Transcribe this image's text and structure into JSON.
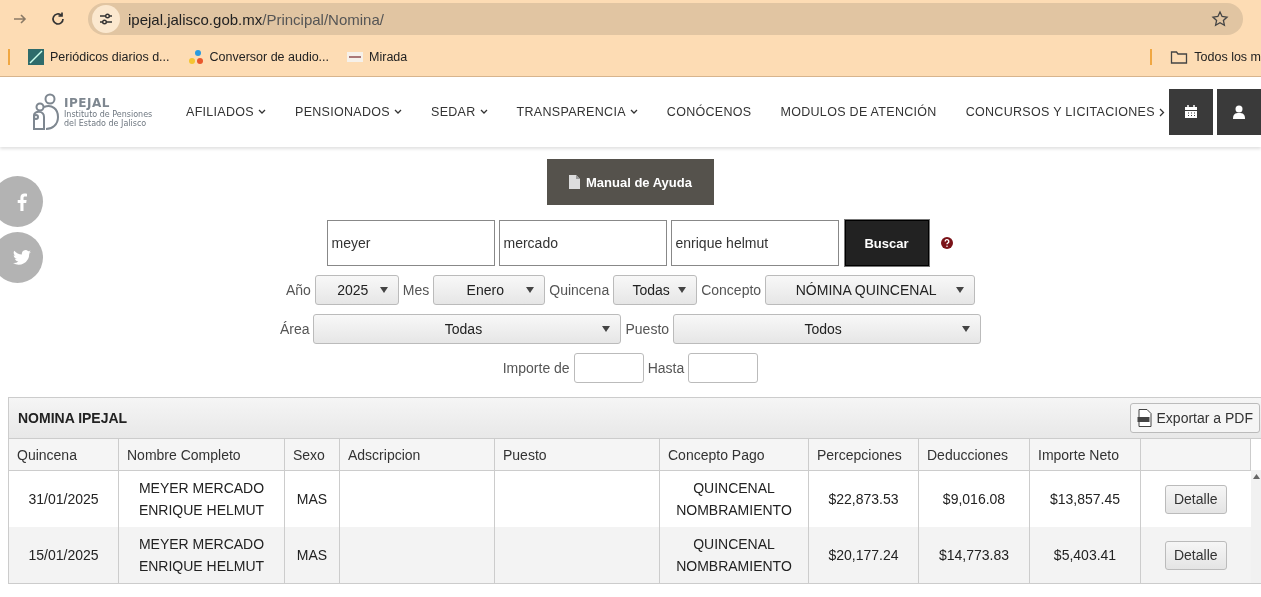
{
  "browser": {
    "url_host": "ipejal.jalisco.gob.mx",
    "url_path": "/Principal/Nomina/",
    "bookmarks": [
      {
        "label": "Periódicos diarios d...",
        "kind": "news"
      },
      {
        "label": "Conversor de audio...",
        "kind": "dots"
      },
      {
        "label": "Mirada",
        "kind": "thumb"
      }
    ],
    "folder": "Todos los m"
  },
  "site": {
    "logo": {
      "name": "IPEJAL",
      "subtitle": "Instituto de Pensiones del Estado de Jalisco"
    },
    "nav": [
      {
        "label": "AFILIADOS",
        "kind": "dropdown"
      },
      {
        "label": "PENSIONADOS",
        "kind": "dropdown"
      },
      {
        "label": "SEDAR",
        "kind": "dropdown"
      },
      {
        "label": "TRANSPARENCIA",
        "kind": "dropdown"
      },
      {
        "label": "CONÓCENOS",
        "kind": "link"
      },
      {
        "label": "MODULOS DE ATENCIÓN",
        "kind": "link"
      },
      {
        "label": "CONCURSOS Y LICITACIONES",
        "kind": "submenu"
      }
    ]
  },
  "help_button": "Manual de Ayuda",
  "search": {
    "fields": [
      "meyer",
      "mercado",
      "enrique helmut"
    ],
    "button": "Buscar"
  },
  "filters": [
    [
      {
        "label": "Año",
        "value": "2025"
      },
      {
        "label": "Mes",
        "value": "Enero"
      },
      {
        "label": "Quincena",
        "value": "Todas"
      },
      {
        "label": "Concepto",
        "value": "NÓMINA QUINCENAL"
      }
    ],
    [
      {
        "label": "Área",
        "value": "Todas"
      },
      {
        "label": "Puesto",
        "value": "Todos"
      }
    ]
  ],
  "amount": {
    "from_label": "Importe de",
    "to_label": "Hasta"
  },
  "table": {
    "title": "NOMINA IPEJAL",
    "export_button": "Exportar a PDF",
    "columns": [
      "Quincena",
      "Nombre Completo",
      "Sexo",
      "Adscripcion",
      "Puesto",
      "Concepto Pago",
      "Percepciones",
      "Deducciones",
      "Importe Neto"
    ],
    "rows": [
      {
        "cells": [
          "31/01/2025",
          "MEYER MERCADO ENRIQUE HELMUT",
          "MAS",
          "",
          "",
          "QUINCENAL NOMBRAMIENTO",
          "$22,873.53",
          "$9,016.08",
          "$13,857.45"
        ],
        "action": "Detalle"
      },
      {
        "cells": [
          "15/01/2025",
          "MEYER MERCADO ENRIQUE HELMUT",
          "MAS",
          "",
          "",
          "QUINCENAL NOMBRAMIENTO",
          "$20,177.24",
          "$14,773.83",
          "$5,403.41"
        ],
        "action": "Detalle"
      }
    ]
  }
}
